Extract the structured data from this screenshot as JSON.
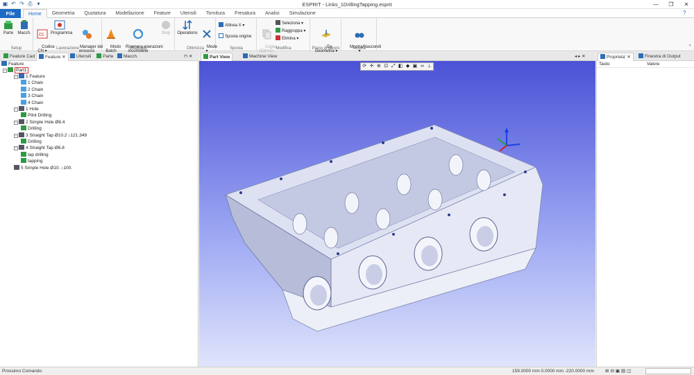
{
  "window": {
    "title": "ESPRIT - Links_1DrillingTapping.esprit"
  },
  "menu": {
    "file": "File",
    "tabs": [
      "Home",
      "Geometria",
      "Quotatura",
      "Modellazione",
      "Feature",
      "Utensili",
      "Tornitura",
      "Fresatura",
      "Analisi",
      "Simulazione"
    ]
  },
  "ribbon": {
    "setup": {
      "label": "Setup",
      "parte": "Parte",
      "macch": "Macch."
    },
    "lavorazione": {
      "label": "Lavorazione",
      "codice": "Codice\nCN ▾",
      "programma": "Programma",
      "manager": "Manager dei\nprocessi"
    },
    "rebuild": {
      "label": "Rebuild",
      "batch": "Modo\nBatch",
      "rigenera": "Rigenera operazioni\nincomplete",
      "stop": "Stop"
    },
    "ottimizza": {
      "label": "Ottimizza",
      "operations": "Operations",
      "mode": "Mode\n▾"
    },
    "sposta": {
      "label": "Sposta",
      "allinea": "Allinea X ▾",
      "sposta_origine": "Sposta origine"
    },
    "modifica": {
      "label": "Modifica",
      "copia": "Copia\n(Ctrl+C)",
      "seleziona": "Seleziona ▾",
      "raggruppa": "Raggruppa ▾",
      "elimina": "Elimina ▾"
    },
    "piano": {
      "label": "Piano di lavoro",
      "da_geometria": "Da\nGeometria ▾"
    },
    "mostra": {
      "label": "Mostra",
      "mostra_nascondi": "Mostra/Nascondi\n▾"
    }
  },
  "left_tabs": [
    "Feature Cad",
    "Feature",
    "Utensili",
    "Parte",
    "Macch."
  ],
  "tree": {
    "root": "Feature",
    "part": "Part1",
    "nodes": [
      "1 Feature",
      "1 Chain",
      "2 Chain",
      "3 Chain",
      "4 Chain",
      "1 Hole",
      "Pilot Drilling",
      "2 Simple Hole Ø8.4",
      "Drilling",
      "3 Straight Tap Ø10.2 ↕121.349",
      "Drilling",
      "4 Straight Tap Ø6.8",
      "tap drilling",
      "tapping",
      "5 Simple Hole Ø10. ↕100."
    ]
  },
  "view_tabs": [
    "Part View",
    "Machine View"
  ],
  "right_tabs": [
    "Proprieta'",
    "Finestra di Output"
  ],
  "properties": {
    "col1": "Tasto",
    "col2": "Valore"
  },
  "status": {
    "left": "Prossimo Comando",
    "coords": "159.0000 mm  0.0000 mm  -220.0000 mm"
  },
  "colors": {
    "accent": "#1e6bc4",
    "viewport_top": "#4b52d6",
    "viewport_bottom": "#dfe4fb",
    "part": "#e9ecf6"
  }
}
